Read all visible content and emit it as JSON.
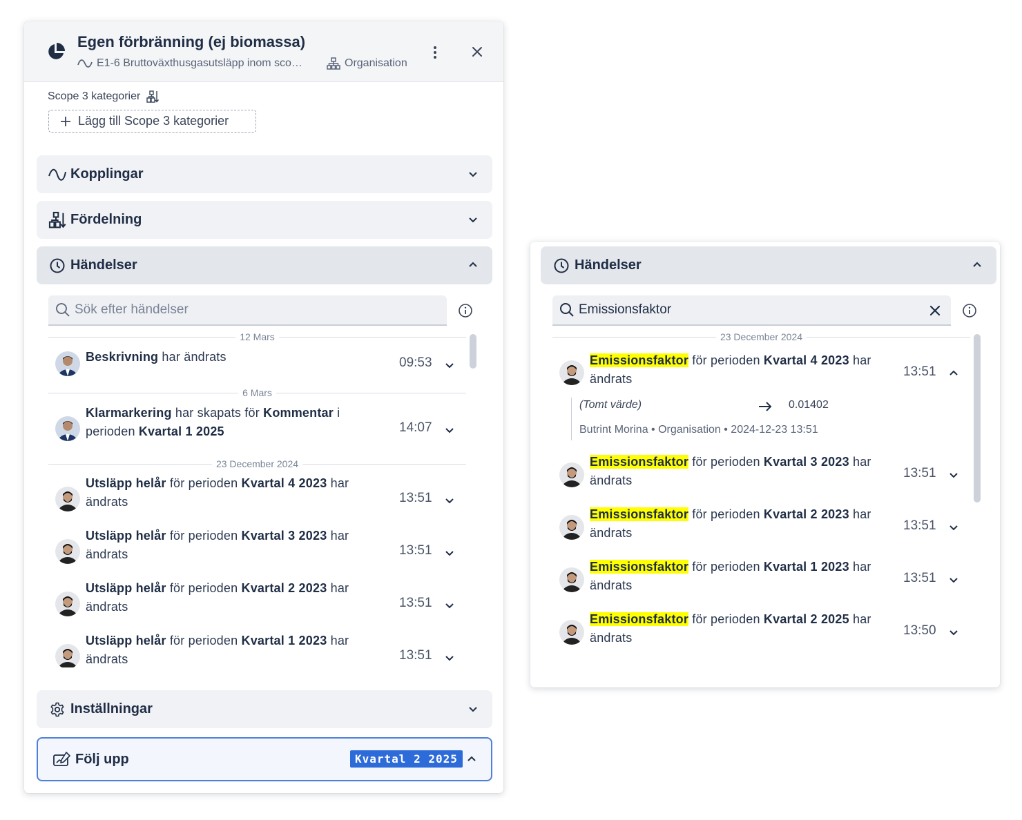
{
  "left": {
    "header": {
      "title": "Egen förbränning (ej biomassa)",
      "subtitle": "E1-6 Bruttoväxthusgasutsläpp inom sco…",
      "org": "Organisation"
    },
    "scope": {
      "label": "Scope 3 kategorier",
      "add_button": "Lägg till Scope 3 kategorier"
    },
    "accordions": {
      "kopplingar": "Kopplingar",
      "fordelning": "Fördelning",
      "handelser": "Händelser",
      "installningar": "Inställningar",
      "folj_upp": "Följ upp",
      "folj_upp_tag": "Kvartal 2 2025"
    },
    "search": {
      "placeholder": "Sök efter händelser",
      "value": ""
    },
    "dates": [
      "12 Mars",
      "6 Mars",
      "23 December 2024"
    ],
    "events": [
      {
        "a": "Beskrivning",
        "b": " har ändrats",
        "time": "09:53"
      },
      {
        "a": "Klarmarkering",
        "b": " har skapats för ",
        "c": "Kommentar",
        "d": " i perioden ",
        "e": "Kvartal 1 2025",
        "time": "14:07"
      },
      {
        "a": "Utsläpp helår",
        "b": " för perioden ",
        "c": "Kvartal 4 2023",
        "d": " har ändrats",
        "time": "13:51"
      },
      {
        "a": "Utsläpp helår",
        "b": " för perioden ",
        "c": "Kvartal 3 2023",
        "d": " har ändrats",
        "time": "13:51"
      },
      {
        "a": "Utsläpp helår",
        "b": " för perioden ",
        "c": "Kvartal 2 2023",
        "d": " har ändrats",
        "time": "13:51"
      },
      {
        "a": "Utsläpp helår",
        "b": " för perioden ",
        "c": "Kvartal 1 2023",
        "d": " har ändrats",
        "time": "13:51"
      }
    ]
  },
  "right": {
    "title": "Händelser",
    "search": {
      "value": "Emissionsfaktor"
    },
    "date": "23 December 2024",
    "detail": {
      "old_value": "(Tomt värde)",
      "new_value": "0.01402",
      "meta": "Butrint Morina • Organisation • 2024-12-23 13:51"
    },
    "events": [
      {
        "a": "Emissionsfaktor",
        "b": " för perioden ",
        "c": "Kvartal 4 2023",
        "d": " har ändrats",
        "time": "13:51"
      },
      {
        "a": "Emissionsfaktor",
        "b": " för perioden ",
        "c": "Kvartal 3 2023",
        "d": " har ändrats",
        "time": "13:51"
      },
      {
        "a": "Emissionsfaktor",
        "b": " för perioden ",
        "c": "Kvartal 2 2023",
        "d": " har ändrats",
        "time": "13:51"
      },
      {
        "a": "Emissionsfaktor",
        "b": " för perioden ",
        "c": "Kvartal 1 2023",
        "d": " har ändrats",
        "time": "13:51"
      },
      {
        "a": "Emissionsfaktor",
        "b": " för perioden ",
        "c": "Kvartal 2 2025",
        "d": " har ändrats",
        "time": "13:50"
      }
    ]
  },
  "icons": {
    "logo": "pie-chart-icon",
    "subtitle": "wave-icon",
    "org": "org-chart-icon",
    "menu": "kebab-icon",
    "close": "close-icon",
    "search": "search-icon",
    "info": "info-icon",
    "settings": "gear-icon",
    "followup": "edit-chart-icon",
    "events": "clock-icon",
    "clear": "clear-icon",
    "arrow": "arrow-right-icon"
  },
  "colors": {
    "highlight": "#ffff00",
    "tag": "#2d6bd9",
    "text": "#1f2d45"
  }
}
